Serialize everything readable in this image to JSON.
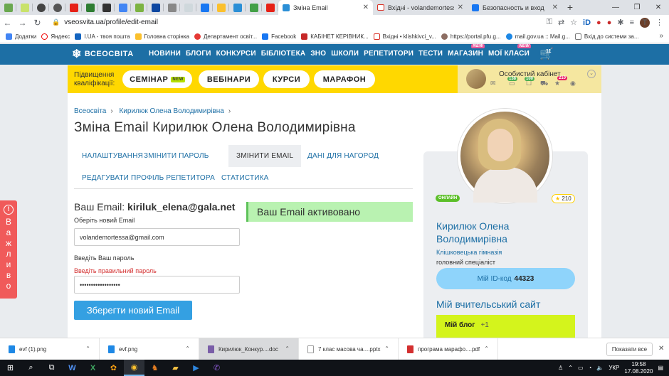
{
  "browser": {
    "active_tab_title": "Зміна Email",
    "tab2_title": "Вхідні - volandemortessa@gm",
    "tab3_title": "Безопасность и вход",
    "url": "vseosvita.ua/profile/edit-email",
    "profile_initial": "T"
  },
  "bookmarks": [
    "Додатки",
    "Яндекс",
    "I.UA - твоя пошта",
    "Головна сторінка",
    "Департамент освіт...",
    "Facebook",
    "КАБІНЕТ КЕРІВНИК...",
    "Вхідні • klishkivci_v...",
    "https://portal.pfu.g...",
    "mail.gov.ua :: Mail.g...",
    "Вхід до системи за..."
  ],
  "site": {
    "logo": "ВСЕОСВІТА",
    "nav": [
      "НОВИНИ",
      "БЛОГИ",
      "КОНКУРСИ",
      "БІБЛІОТЕКА",
      "ЗНО",
      "ШКОЛИ",
      "РЕПЕТИТОРИ",
      "ТЕСТИ",
      "МАГАЗИН",
      "МОЇ КЛАСИ"
    ],
    "new_tag": "NEW",
    "cart_count": "11",
    "qual_label": "Підвищення кваліфікації:",
    "pills": [
      "СЕМІНАР",
      "ВЕБІНАРИ",
      "КУРСИ",
      "МАРАФОН"
    ],
    "seminar_new": "NEW",
    "cabinet_title": "Особистий кабінет",
    "badges": [
      "138",
      "100",
      "210"
    ]
  },
  "page": {
    "breadcrumbs": [
      "Всеосвіта",
      "Кирилюк Олена Володимирівна"
    ],
    "title": "Зміна Email Кирилюк Олена Володимирівна",
    "tabs": [
      "НАЛАШТУВАННЯ",
      "ЗМІНИТИ ПАРОЛЬ",
      "ЗМІНИТИ EMAIL",
      "ДАНІ ДЛЯ НАГОРОД",
      "РЕДАГУВАТИ ПРОФІЛЬ РЕПЕТИТОРА",
      "СТАТИСТИКА"
    ],
    "your_email_label": "Ваш Email:",
    "your_email": "kiriluk_elena@gala.net",
    "new_email_label": "Оберіть новий Email",
    "new_email_value": "volandemortessa@gmail.com",
    "password_label": "Введіть Ваш пароль",
    "password_error": "Введіть правильний пароль",
    "password_value": "••••••••••••••••••",
    "save_button": "Зберегти новий Email",
    "success_msg": "Ваш Email активовано"
  },
  "profile": {
    "online": "ОНЛАЙН",
    "rating": "210",
    "name": "Кирилюк Олена Володимирівна",
    "school": "Клішковецька гімназія",
    "role": "головний спеціаліст",
    "id_label": "Мій ID-код",
    "id_code": "44323",
    "site_title": "Мій вчительський сайт",
    "blog_label": "Мій блог",
    "blog_add": "+1"
  },
  "important_tab": "Важливо",
  "downloads": [
    "evf (1).png",
    "evf.png",
    "Кирилюк_Конкур....doc",
    "7 клас масова ча....pptx",
    "програма марафо....pdf"
  ],
  "downloads_show_all": "Показати все",
  "taskbar": {
    "lang": "УКР",
    "time": "19:58",
    "date": "17.08.2020"
  },
  "colors": {
    "brand_blue": "#1d6fa5",
    "yellow": "#ffd800",
    "success_green": "#b9f2b1",
    "button_blue": "#34a0e2",
    "lime": "#d4f41c",
    "danger": "#f05a5a"
  }
}
